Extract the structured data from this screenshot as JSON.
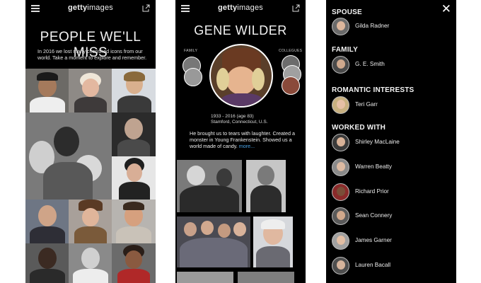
{
  "app": {
    "logo_brand": "getty",
    "logo_suffix": "images"
  },
  "screen1": {
    "title": "PEOPLE WE'LL MISS",
    "intro": "In 2016 we lost many cherished icons from our world. Take a moment to explore and remember."
  },
  "screen2": {
    "title": "GENE WILDER",
    "family_label": "FAMILY",
    "colleagues_label": "COLLEGUES",
    "dates": "1933 - 2016 (age 83)",
    "birthplace": "Stamford, Connecticut, U.S.",
    "bio": "He brought us to tears with laughter. Created a monster in Young Frankenstein. Showed us a world made of candy.",
    "more": "more..."
  },
  "screen3": {
    "sections": [
      {
        "heading": "SPOUSE",
        "people": [
          "Gilda Radner"
        ]
      },
      {
        "heading": "FAMILY",
        "people": [
          "G. E. Smith"
        ]
      },
      {
        "heading": "ROMANTIC INTERESTS",
        "people": [
          "Teri Garr"
        ]
      },
      {
        "heading": "WORKED WITH",
        "people": [
          "Shirley MacLaine",
          "Warren Beatty",
          "Richard Prior",
          "Sean Connery",
          "James Garner",
          "Lauren Bacall"
        ]
      }
    ]
  },
  "icons": {
    "menu": "hamburger-icon",
    "share": "share-icon",
    "close": "close-icon"
  }
}
